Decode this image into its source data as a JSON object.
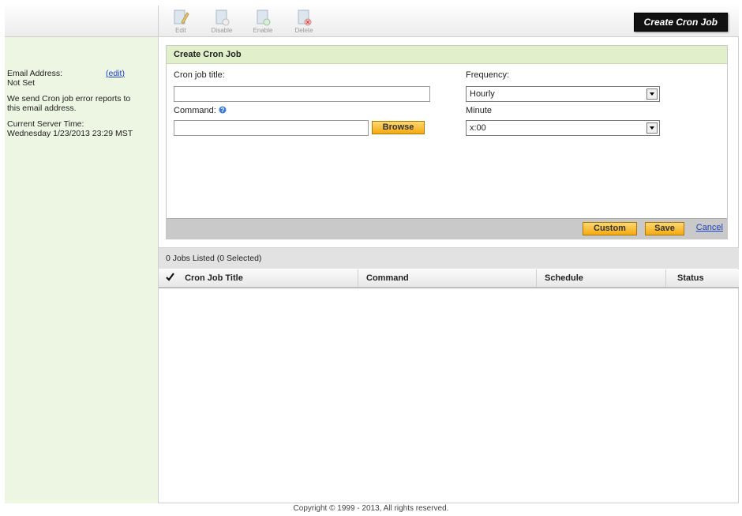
{
  "sidebar": {
    "email_label": "Email Address:",
    "email_edit": "edit",
    "email_value": "Not Set",
    "error_reports_line1": "We send Cron job error reports to",
    "error_reports_line2": "this email address.",
    "server_time_label": "Current Server Time:",
    "server_time_value": "Wednesday 1/23/2013 23:29 MST"
  },
  "toolbar": {
    "buttons": [
      {
        "label": "Edit",
        "icon": "edit-icon"
      },
      {
        "label": "Disable",
        "icon": "disable-icon"
      },
      {
        "label": "Enable",
        "icon": "enable-icon"
      },
      {
        "label": "Delete",
        "icon": "delete-icon"
      }
    ],
    "create_label": "Create Cron Job"
  },
  "form": {
    "title": "Create Cron Job",
    "title_label": "Cron job title:",
    "title_value": "",
    "command_label": "Command:",
    "command_value": "",
    "browse_label": "Browse",
    "frequency_label": "Frequency:",
    "frequency_value": "Hourly",
    "minute_label": "Minute",
    "minute_value": "x:00",
    "custom_label": "Custom",
    "save_label": "Save",
    "cancel_label": "Cancel"
  },
  "jobs": {
    "summary": "0 Jobs Listed (0 Selected)",
    "columns": [
      "Cron Job Title",
      "Command",
      "Schedule",
      "Status"
    ]
  },
  "footer": {
    "copyright": "Copyright © 1999 - 2013, All rights reserved."
  }
}
